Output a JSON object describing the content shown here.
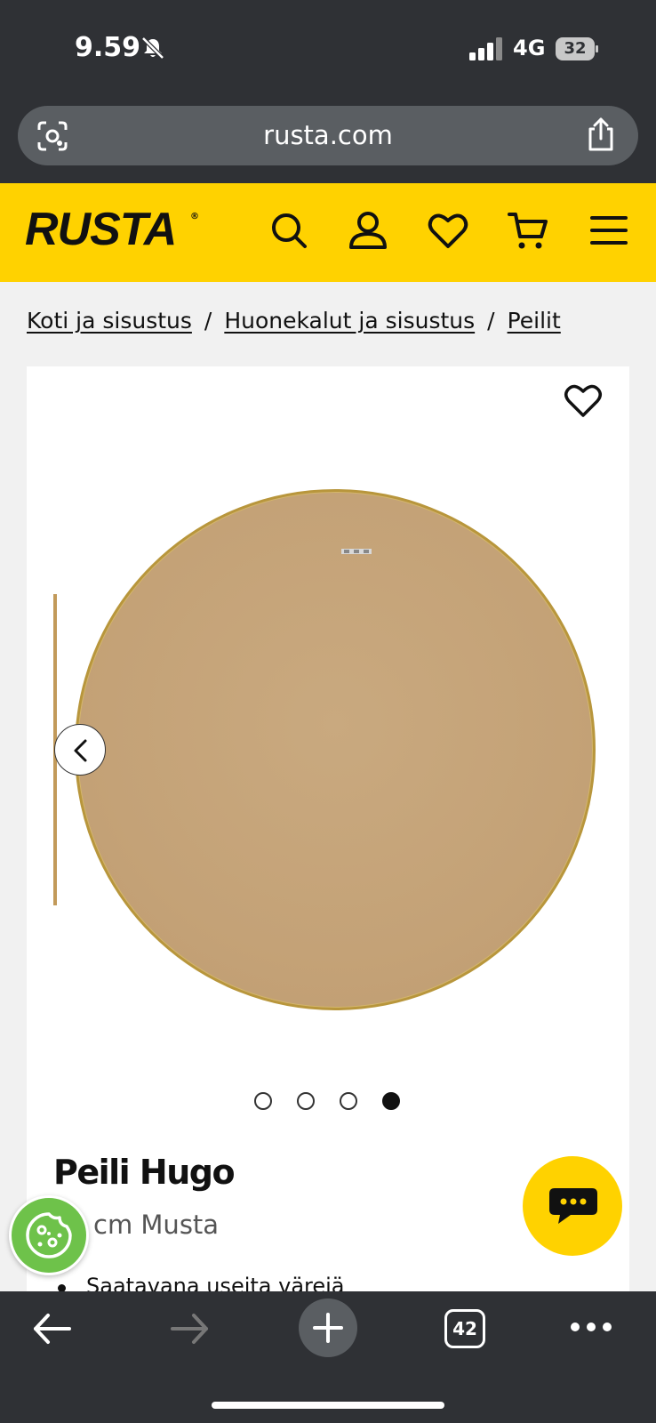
{
  "status_bar": {
    "time": "9.59",
    "network": "4G",
    "battery": "32",
    "icons": [
      "bell-muted-icon",
      "signal-icon",
      "battery-icon"
    ]
  },
  "browser": {
    "url": "rusta.com",
    "icons": [
      "lens-icon",
      "share-icon"
    ]
  },
  "header": {
    "logo": "RUSTA",
    "logo_mark": "®",
    "brand_color": "#ffd200",
    "icons": [
      "search-icon",
      "account-icon",
      "wishlist-icon",
      "cart-icon",
      "menu-icon"
    ]
  },
  "breadcrumb": {
    "items": [
      "Koti ja sisustus",
      "Huonekalut ja sisustus",
      "Peilit"
    ],
    "separator": "/"
  },
  "product": {
    "title": "Peili Hugo",
    "subtitle_visible": "cm Musta",
    "bullet": "Saatavana useita värejä",
    "gallery": {
      "image_count": 4,
      "active_index": 3
    }
  },
  "widgets": {
    "chat_icon": "chat-icon",
    "cookie_icon": "cookie-icon"
  },
  "bottom_bar": {
    "tab_count": "42",
    "icons": [
      "back-arrow-icon",
      "forward-arrow-icon",
      "new-tab-icon",
      "tabs-icon",
      "more-icon"
    ]
  }
}
